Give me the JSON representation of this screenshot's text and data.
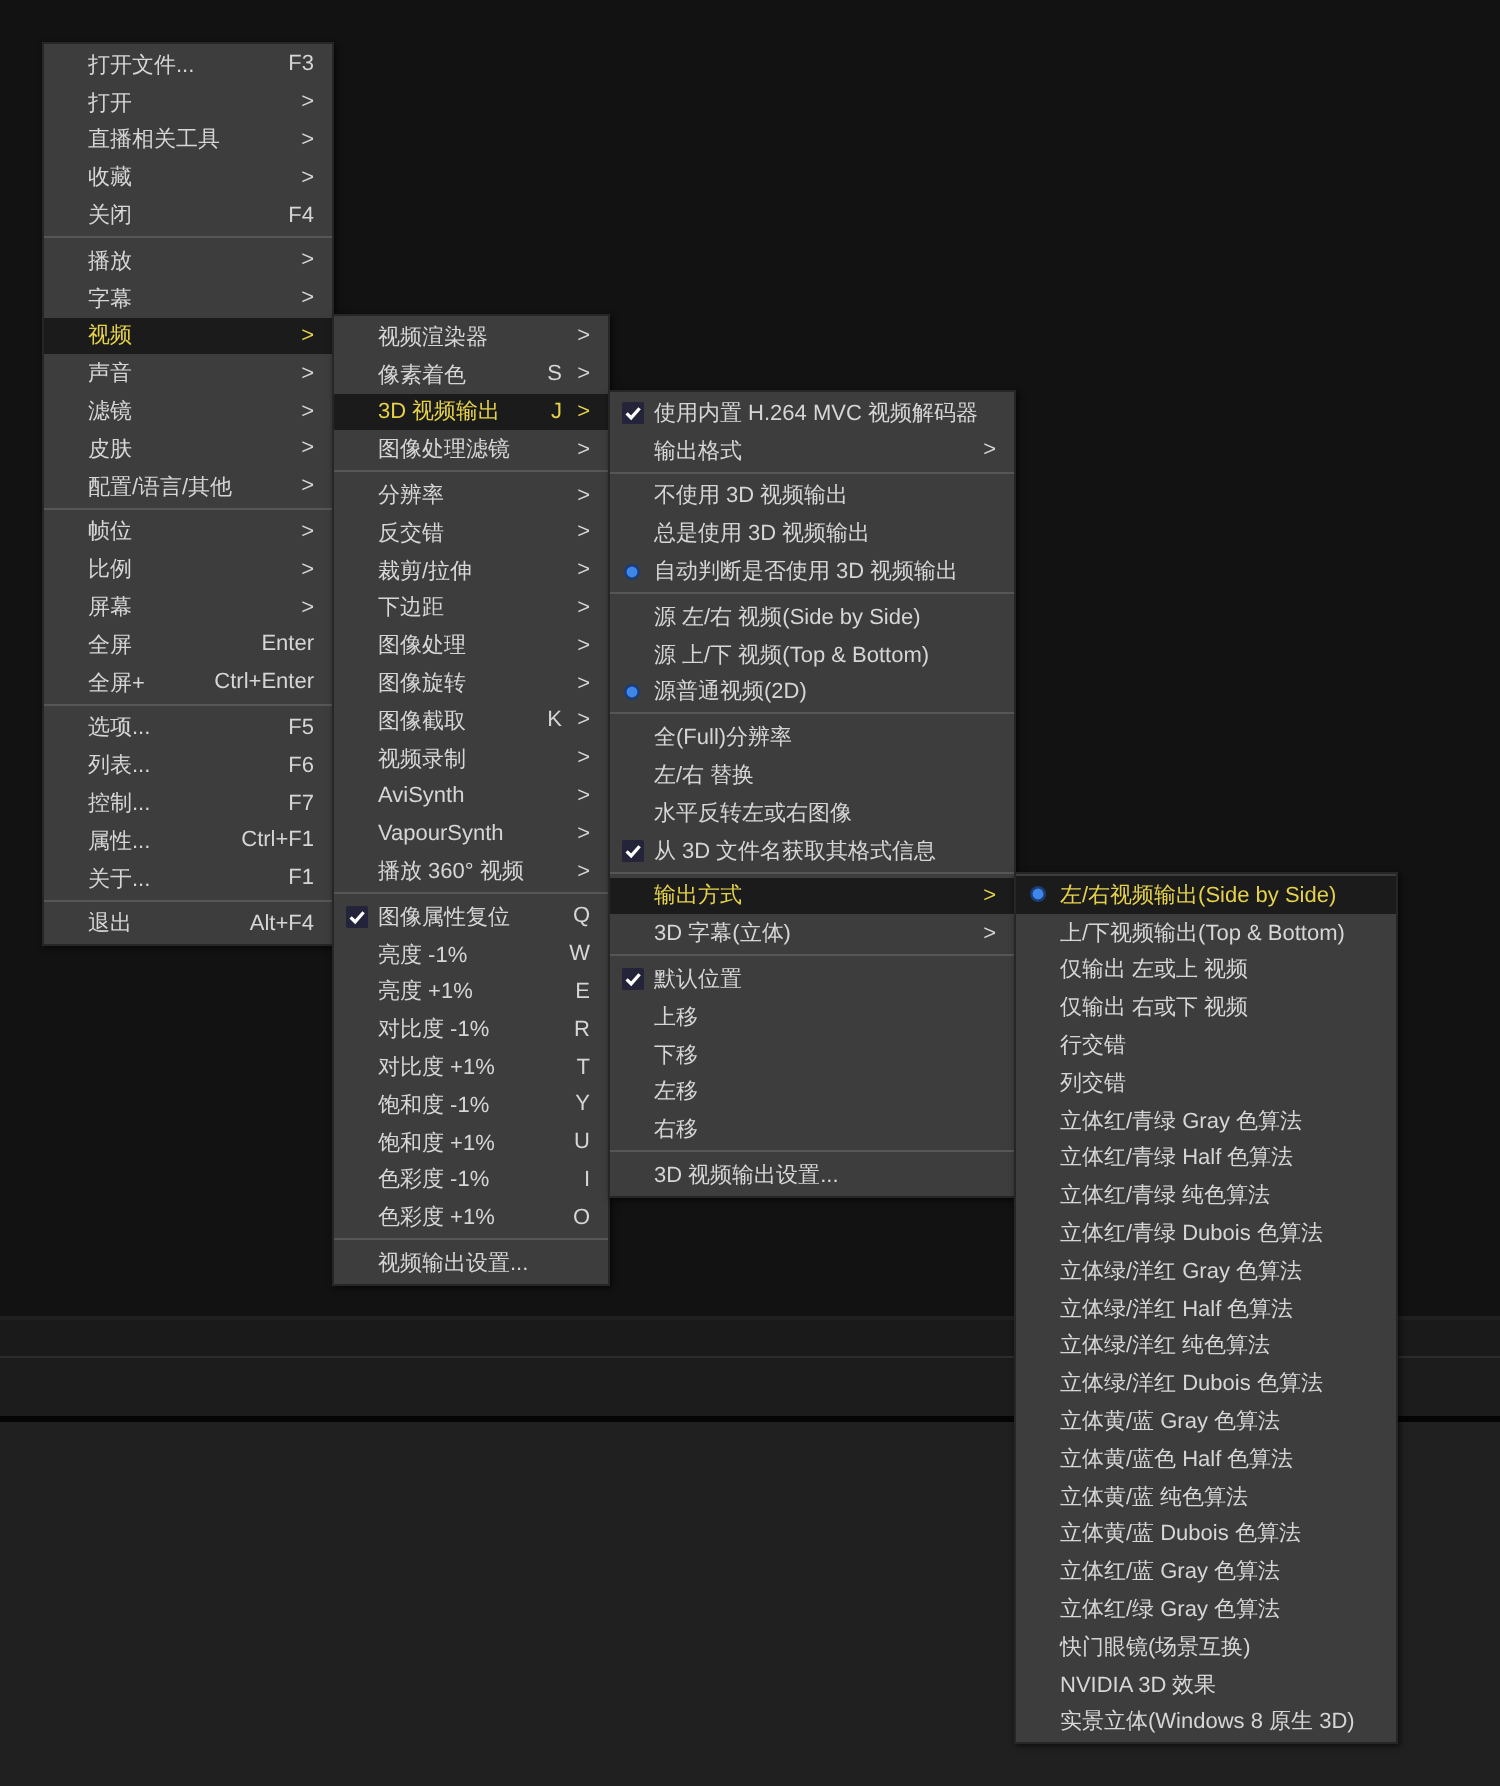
{
  "menus": [
    {
      "items": [
        {
          "kind": "plain",
          "label": "打开文件...",
          "shortcut": "F3",
          "highlighted": false
        },
        {
          "kind": "plain",
          "label": "打开",
          "arrow": ">",
          "highlighted": false
        },
        {
          "kind": "plain",
          "label": "直播相关工具",
          "arrow": ">",
          "highlighted": false
        },
        {
          "kind": "plain",
          "label": "收藏",
          "arrow": ">",
          "highlighted": false
        },
        {
          "kind": "plain",
          "label": "关闭",
          "shortcut": "F4",
          "highlighted": false
        },
        {
          "kind": "separator"
        },
        {
          "kind": "plain",
          "label": "播放",
          "arrow": ">",
          "highlighted": false
        },
        {
          "kind": "plain",
          "label": "字幕",
          "arrow": ">",
          "highlighted": false
        },
        {
          "kind": "plain",
          "label": "视频",
          "arrow": ">",
          "highlighted": true
        },
        {
          "kind": "plain",
          "label": "声音",
          "arrow": ">",
          "highlighted": false
        },
        {
          "kind": "plain",
          "label": "滤镜",
          "arrow": ">",
          "highlighted": false
        },
        {
          "kind": "plain",
          "label": "皮肤",
          "arrow": ">",
          "highlighted": false
        },
        {
          "kind": "plain",
          "label": "配置/语言/其他",
          "arrow": ">",
          "highlighted": false
        },
        {
          "kind": "separator"
        },
        {
          "kind": "plain",
          "label": "帧位",
          "arrow": ">",
          "highlighted": false
        },
        {
          "kind": "plain",
          "label": "比例",
          "arrow": ">",
          "highlighted": false
        },
        {
          "kind": "plain",
          "label": "屏幕",
          "arrow": ">",
          "highlighted": false
        },
        {
          "kind": "plain",
          "label": "全屏",
          "shortcut": "Enter",
          "highlighted": false
        },
        {
          "kind": "plain",
          "label": "全屏+",
          "shortcut": "Ctrl+Enter",
          "highlighted": false
        },
        {
          "kind": "separator"
        },
        {
          "kind": "plain",
          "label": "选项...",
          "shortcut": "F5",
          "highlighted": false
        },
        {
          "kind": "plain",
          "label": "列表...",
          "shortcut": "F6",
          "highlighted": false
        },
        {
          "kind": "plain",
          "label": "控制...",
          "shortcut": "F7",
          "highlighted": false
        },
        {
          "kind": "plain",
          "label": "属性...",
          "shortcut": "Ctrl+F1",
          "highlighted": false
        },
        {
          "kind": "plain",
          "label": "关于...",
          "shortcut": "F1",
          "highlighted": false
        },
        {
          "kind": "separator"
        },
        {
          "kind": "plain",
          "label": "退出",
          "shortcut": "Alt+F4",
          "highlighted": false
        }
      ]
    },
    {
      "items": [
        {
          "kind": "plain",
          "label": "视频渲染器",
          "arrow": ">",
          "highlighted": false
        },
        {
          "kind": "plain",
          "label": "像素着色",
          "shortcut": "S",
          "arrow": ">",
          "highlighted": false
        },
        {
          "kind": "plain",
          "label": "3D 视频输出",
          "shortcut": "J",
          "arrow": ">",
          "highlighted": true
        },
        {
          "kind": "plain",
          "label": "图像处理滤镜",
          "arrow": ">",
          "highlighted": false
        },
        {
          "kind": "separator"
        },
        {
          "kind": "plain",
          "label": "分辨率",
          "arrow": ">",
          "highlighted": false
        },
        {
          "kind": "plain",
          "label": "反交错",
          "arrow": ">",
          "highlighted": false
        },
        {
          "kind": "plain",
          "label": "裁剪/拉伸",
          "arrow": ">",
          "highlighted": false
        },
        {
          "kind": "plain",
          "label": "下边距",
          "arrow": ">",
          "highlighted": false
        },
        {
          "kind": "plain",
          "label": "图像处理",
          "arrow": ">",
          "highlighted": false
        },
        {
          "kind": "plain",
          "label": "图像旋转",
          "arrow": ">",
          "highlighted": false
        },
        {
          "kind": "plain",
          "label": "图像截取",
          "shortcut": "K",
          "arrow": ">",
          "highlighted": false
        },
        {
          "kind": "plain",
          "label": "视频录制",
          "arrow": ">",
          "highlighted": false
        },
        {
          "kind": "plain",
          "label": "AviSynth",
          "arrow": ">",
          "highlighted": false
        },
        {
          "kind": "plain",
          "label": "VapourSynth",
          "arrow": ">",
          "highlighted": false
        },
        {
          "kind": "plain",
          "label": "播放 360° 视频",
          "arrow": ">",
          "highlighted": false
        },
        {
          "kind": "separator"
        },
        {
          "kind": "check",
          "checked": true,
          "label": "图像属性复位",
          "shortcut": "Q",
          "highlighted": false
        },
        {
          "kind": "plain",
          "label": "亮度 -1%",
          "shortcut": "W",
          "highlighted": false
        },
        {
          "kind": "plain",
          "label": "亮度 +1%",
          "shortcut": "E",
          "highlighted": false
        },
        {
          "kind": "plain",
          "label": "对比度 -1%",
          "shortcut": "R",
          "highlighted": false
        },
        {
          "kind": "plain",
          "label": "对比度 +1%",
          "shortcut": "T",
          "highlighted": false
        },
        {
          "kind": "plain",
          "label": "饱和度 -1%",
          "shortcut": "Y",
          "highlighted": false
        },
        {
          "kind": "plain",
          "label": "饱和度 +1%",
          "shortcut": "U",
          "highlighted": false
        },
        {
          "kind": "plain",
          "label": "色彩度 -1%",
          "shortcut": "I",
          "highlighted": false
        },
        {
          "kind": "plain",
          "label": "色彩度 +1%",
          "shortcut": "O",
          "highlighted": false
        },
        {
          "kind": "separator"
        },
        {
          "kind": "plain",
          "label": "视频输出设置...",
          "highlighted": false
        }
      ]
    },
    {
      "items": [
        {
          "kind": "check",
          "checked": true,
          "label": "使用内置 H.264 MVC 视频解码器",
          "highlighted": false
        },
        {
          "kind": "plain",
          "label": "输出格式",
          "arrow": ">",
          "highlighted": false
        },
        {
          "kind": "separator"
        },
        {
          "kind": "radio",
          "checked": false,
          "label": "不使用 3D 视频输出",
          "highlighted": false
        },
        {
          "kind": "radio",
          "checked": false,
          "label": "总是使用 3D 视频输出",
          "highlighted": false
        },
        {
          "kind": "radio",
          "checked": true,
          "label": "自动判断是否使用 3D 视频输出",
          "highlighted": false
        },
        {
          "kind": "separator"
        },
        {
          "kind": "radio",
          "checked": false,
          "label": "源 左/右 视频(Side by Side)",
          "highlighted": false
        },
        {
          "kind": "radio",
          "checked": false,
          "label": "源 上/下 视频(Top & Bottom)",
          "highlighted": false
        },
        {
          "kind": "radio",
          "checked": true,
          "label": "源普通视频(2D)",
          "highlighted": false
        },
        {
          "kind": "separator"
        },
        {
          "kind": "check",
          "checked": false,
          "label": "全(Full)分辨率",
          "highlighted": false
        },
        {
          "kind": "check",
          "checked": false,
          "label": "左/右 替换",
          "highlighted": false
        },
        {
          "kind": "check",
          "checked": false,
          "label": "水平反转左或右图像",
          "highlighted": false
        },
        {
          "kind": "check",
          "checked": true,
          "label": "从 3D 文件名获取其格式信息",
          "highlighted": false
        },
        {
          "kind": "separator"
        },
        {
          "kind": "plain",
          "label": "输出方式",
          "arrow": ">",
          "highlighted": true
        },
        {
          "kind": "plain",
          "label": "3D 字幕(立体)",
          "arrow": ">",
          "highlighted": false
        },
        {
          "kind": "separator"
        },
        {
          "kind": "check",
          "checked": true,
          "label": "默认位置",
          "highlighted": false
        },
        {
          "kind": "plain",
          "label": "上移",
          "highlighted": false
        },
        {
          "kind": "plain",
          "label": "下移",
          "highlighted": false
        },
        {
          "kind": "plain",
          "label": "左移",
          "highlighted": false
        },
        {
          "kind": "plain",
          "label": "右移",
          "highlighted": false
        },
        {
          "kind": "separator"
        },
        {
          "kind": "plain",
          "label": "3D 视频输出设置...",
          "highlighted": false
        }
      ]
    },
    {
      "items": [
        {
          "kind": "radio",
          "checked": true,
          "label": "左/右视频输出(Side by Side)",
          "highlighted": true
        },
        {
          "kind": "radio",
          "checked": false,
          "label": "上/下视频输出(Top & Bottom)",
          "highlighted": false
        },
        {
          "kind": "radio",
          "checked": false,
          "label": "仅输出 左或上 视频",
          "highlighted": false
        },
        {
          "kind": "radio",
          "checked": false,
          "label": "仅输出 右或下 视频",
          "highlighted": false
        },
        {
          "kind": "radio",
          "checked": false,
          "label": "行交错",
          "highlighted": false
        },
        {
          "kind": "radio",
          "checked": false,
          "label": "列交错",
          "highlighted": false
        },
        {
          "kind": "radio",
          "checked": false,
          "label": "立体红/青绿 Gray 色算法",
          "highlighted": false
        },
        {
          "kind": "radio",
          "checked": false,
          "label": "立体红/青绿 Half 色算法",
          "highlighted": false
        },
        {
          "kind": "radio",
          "checked": false,
          "label": "立体红/青绿 纯色算法",
          "highlighted": false
        },
        {
          "kind": "radio",
          "checked": false,
          "label": "立体红/青绿 Dubois 色算法",
          "highlighted": false
        },
        {
          "kind": "radio",
          "checked": false,
          "label": "立体绿/洋红 Gray 色算法",
          "highlighted": false
        },
        {
          "kind": "radio",
          "checked": false,
          "label": "立体绿/洋红 Half 色算法",
          "highlighted": false
        },
        {
          "kind": "radio",
          "checked": false,
          "label": "立体绿/洋红 纯色算法",
          "highlighted": false
        },
        {
          "kind": "radio",
          "checked": false,
          "label": "立体绿/洋红 Dubois 色算法",
          "highlighted": false
        },
        {
          "kind": "radio",
          "checked": false,
          "label": "立体黄/蓝 Gray 色算法",
          "highlighted": false
        },
        {
          "kind": "radio",
          "checked": false,
          "label": "立体黄/蓝色 Half 色算法",
          "highlighted": false
        },
        {
          "kind": "radio",
          "checked": false,
          "label": "立体黄/蓝 纯色算法",
          "highlighted": false
        },
        {
          "kind": "radio",
          "checked": false,
          "label": "立体黄/蓝 Dubois 色算法",
          "highlighted": false
        },
        {
          "kind": "radio",
          "checked": false,
          "label": "立体红/蓝 Gray 色算法",
          "highlighted": false
        },
        {
          "kind": "radio",
          "checked": false,
          "label": "立体红/绿 Gray 色算法",
          "highlighted": false
        },
        {
          "kind": "radio",
          "checked": false,
          "label": "快门眼镜(场景互换)",
          "highlighted": false
        },
        {
          "kind": "radio",
          "checked": false,
          "label": "NVIDIA 3D 效果",
          "highlighted": false
        },
        {
          "kind": "radio",
          "checked": false,
          "label": "实景立体(Windows 8 原生 3D)",
          "highlighted": false
        }
      ]
    }
  ]
}
